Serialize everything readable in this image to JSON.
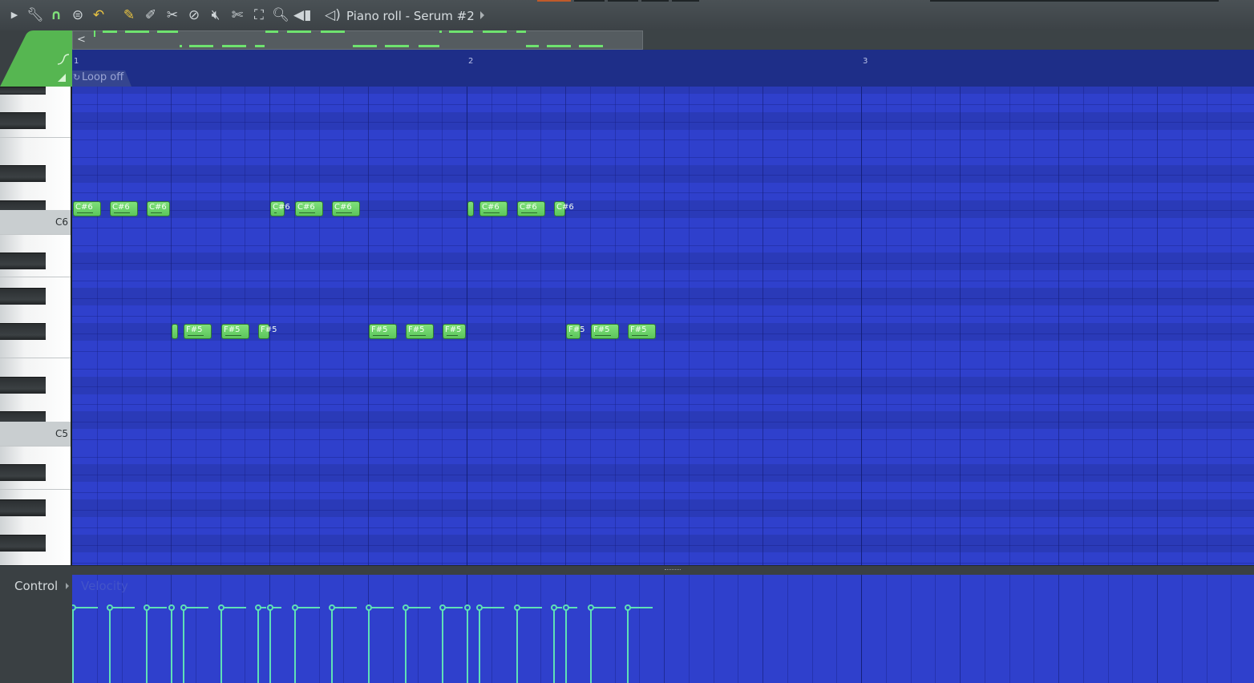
{
  "window": {
    "title": "Piano roll - Serum #2"
  },
  "toolbar": {
    "icons": [
      "menu-arrow-icon",
      "wrench-icon",
      "magnet-icon",
      "snap-menu-icon",
      "undo-icon",
      "pencil-icon",
      "paint-brush-icon",
      "delete-tool-icon",
      "ban-icon",
      "mute-icon",
      "slice-tool-icon",
      "select-icon",
      "zoom-icon",
      "playback-icon"
    ],
    "title_icon": "speaker-icon"
  },
  "timeline": {
    "bars": [
      "1",
      "2",
      "3"
    ],
    "loop_label": "Loop off"
  },
  "keyboard": {
    "labels": {
      "c6": "C6",
      "c5": "C5"
    }
  },
  "notes": [
    {
      "pitch": "C#6",
      "start": 0,
      "length": 0.3,
      "label": "C#6"
    },
    {
      "pitch": "C#6",
      "start": 0.375,
      "length": 0.3,
      "label": "C#6"
    },
    {
      "pitch": "C#6",
      "start": 0.75,
      "length": 0.25,
      "label": "C#6"
    },
    {
      "pitch": "F#5",
      "start": 1.0,
      "length": 0.04,
      "label": ""
    },
    {
      "pitch": "F#5",
      "start": 1.125,
      "length": 0.3,
      "label": "F#5"
    },
    {
      "pitch": "F#5",
      "start": 1.5,
      "length": 0.3,
      "label": "F#5"
    },
    {
      "pitch": "F#5",
      "start": 1.875,
      "length": 0.13,
      "label": "F#5"
    },
    {
      "pitch": "C#6",
      "start": 2.0,
      "length": 0.16,
      "label": "C#6"
    },
    {
      "pitch": "C#6",
      "start": 2.25,
      "length": 0.3,
      "label": "C#6"
    },
    {
      "pitch": "C#6",
      "start": 2.625,
      "length": 0.3,
      "label": "C#6"
    },
    {
      "pitch": "F#5",
      "start": 3.0,
      "length": 0.3,
      "label": "F#5"
    },
    {
      "pitch": "F#5",
      "start": 3.375,
      "length": 0.3,
      "label": "F#5"
    },
    {
      "pitch": "F#5",
      "start": 3.75,
      "length": 0.25,
      "label": "F#5"
    },
    {
      "pitch": "C#6",
      "start": 4.0,
      "length": 0.04,
      "label": ""
    },
    {
      "pitch": "C#6",
      "start": 4.125,
      "length": 0.3,
      "label": "C#6"
    },
    {
      "pitch": "C#6",
      "start": 4.5,
      "length": 0.3,
      "label": "C#6"
    },
    {
      "pitch": "C#6",
      "start": 4.875,
      "length": 0.13,
      "label": "C#6"
    },
    {
      "pitch": "F#5",
      "start": 5.0,
      "length": 0.16,
      "label": "F#5"
    },
    {
      "pitch": "F#5",
      "start": 5.25,
      "length": 0.3,
      "label": "F#5"
    },
    {
      "pitch": "F#5",
      "start": 5.625,
      "length": 0.3,
      "label": "F#5"
    }
  ],
  "control": {
    "label": "Control",
    "parameter": "Velocity"
  },
  "colors": {
    "grid_background": "#2f40cc",
    "note_fill": "#6ad366",
    "velocity_line": "#5fe0b6"
  }
}
